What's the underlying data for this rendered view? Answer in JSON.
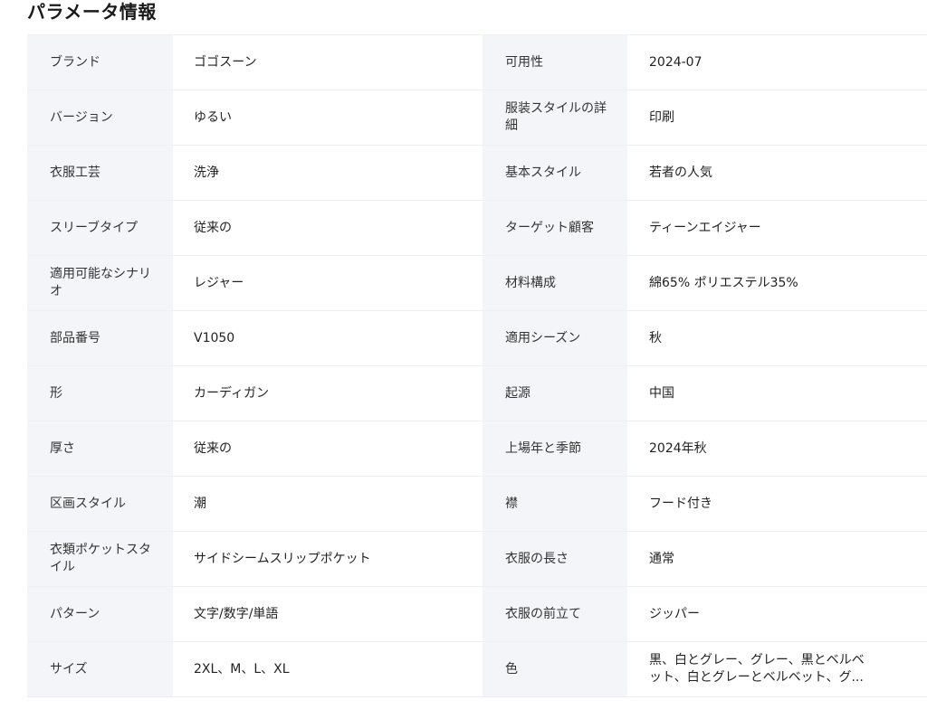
{
  "title": "パラメータ情報",
  "rows": [
    {
      "k1": "ブランド",
      "v1": "ゴゴスーン",
      "k2": "可用性",
      "v2": "2024-07"
    },
    {
      "k1": "バージョン",
      "v1": "ゆるい",
      "k2": "服装スタイルの詳細",
      "v2": "印刷"
    },
    {
      "k1": "衣服工芸",
      "v1": "洗浄",
      "k2": "基本スタイル",
      "v2": "若者の人気"
    },
    {
      "k1": "スリーブタイプ",
      "v1": "従来の",
      "k2": "ターゲット顧客",
      "v2": "ティーンエイジャー"
    },
    {
      "k1": "適用可能なシナリオ",
      "v1": "レジャー",
      "k2": "材料構成",
      "v2": "綿65% ポリエステル35%"
    },
    {
      "k1": "部品番号",
      "v1": "V1050",
      "k2": "適用シーズン",
      "v2": "秋"
    },
    {
      "k1": "形",
      "v1": "カーディガン",
      "k2": "起源",
      "v2": "中国"
    },
    {
      "k1": "厚さ",
      "v1": "従来の",
      "k2": "上場年と季節",
      "v2": "2024年秋"
    },
    {
      "k1": "区画スタイル",
      "v1": "潮",
      "k2": "襟",
      "v2": "フード付き"
    },
    {
      "k1": "衣類ポケットスタイル",
      "v1": "サイドシームスリップポケット",
      "k2": "衣服の長さ",
      "v2": "通常"
    },
    {
      "k1": "パターン",
      "v1": "文字/数字/単語",
      "k2": "衣服の前立て",
      "v2": "ジッパー"
    },
    {
      "k1": "サイズ",
      "v1": "2XL、M、L、XL",
      "k2": "色",
      "v2": "黒、白とグレー、グレー、黒とベルベット、白とグレーとベルベット、グ..."
    }
  ]
}
